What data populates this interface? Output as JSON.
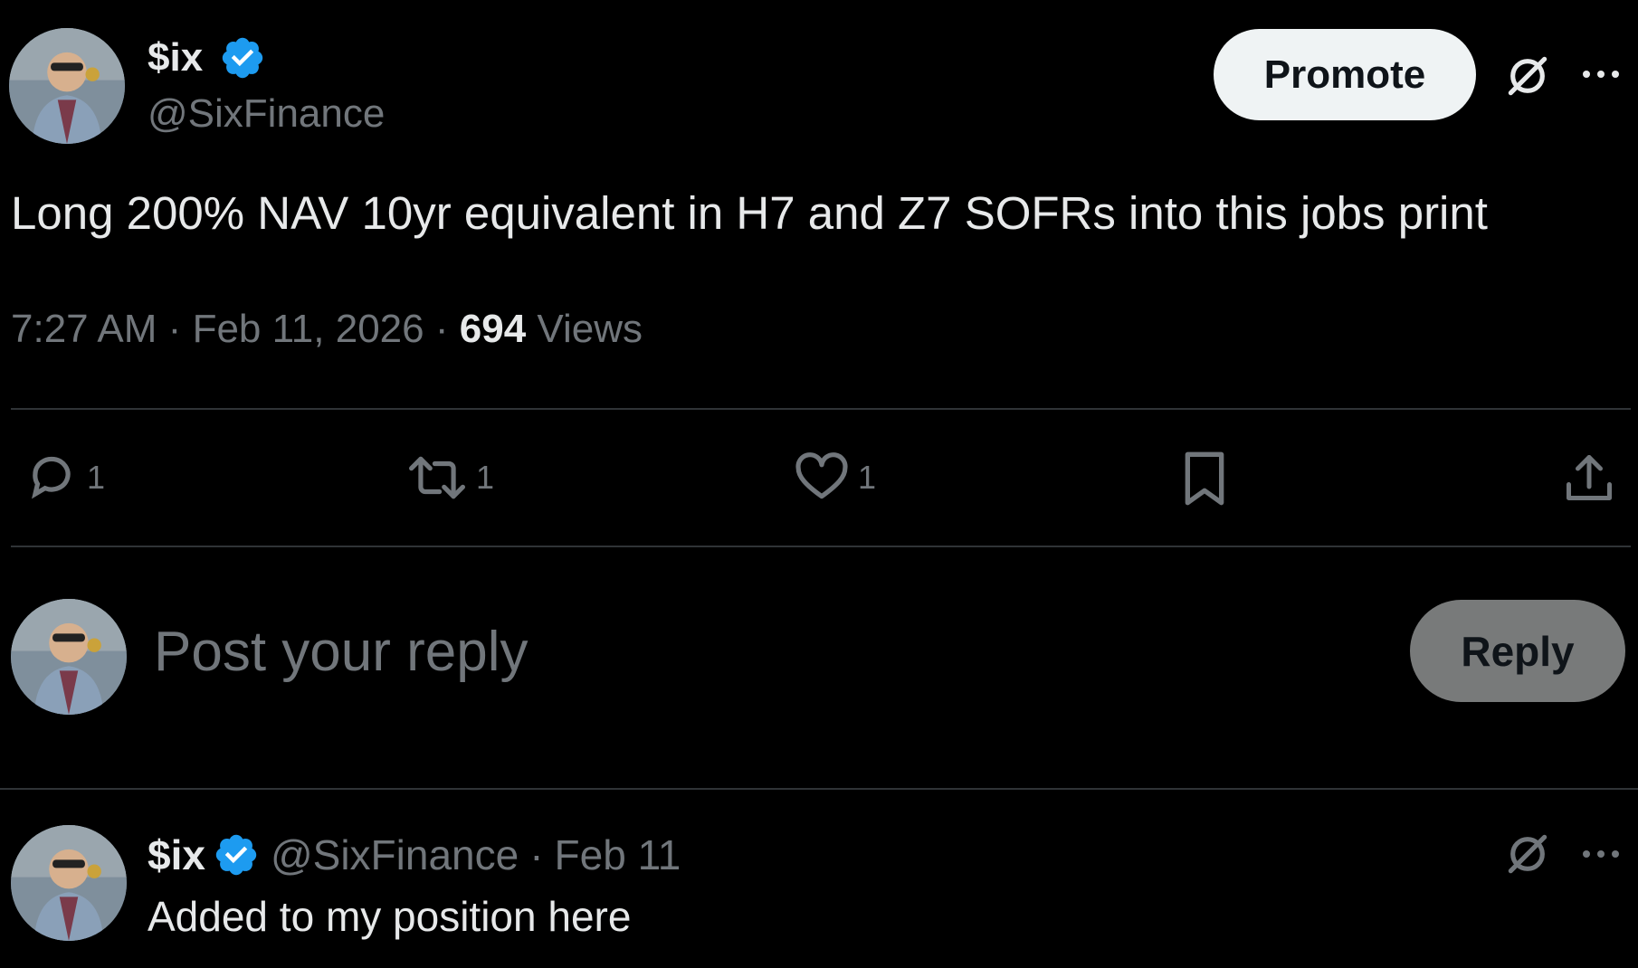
{
  "tweet": {
    "author": {
      "name": "$ix",
      "handle": "@SixFinance",
      "verified": true
    },
    "promote_label": "Promote",
    "text": "Long 200% NAV 10yr equivalent in H7 and Z7 SOFRs into this jobs print",
    "time": "7:27 AM",
    "date": "Feb 11, 2026",
    "views_count": "694",
    "views_label": "Views",
    "separator": "·",
    "actions": {
      "reply_count": "1",
      "repost_count": "1",
      "like_count": "1"
    }
  },
  "composer": {
    "placeholder": "Post your reply",
    "reply_label": "Reply"
  },
  "reply": {
    "name": "$ix",
    "handle": "@SixFinance",
    "separator": "·",
    "date": "Feb 11",
    "text": "Added to my position here"
  },
  "colors": {
    "background": "#000000",
    "text": "#e7e9ea",
    "muted": "#71767b",
    "divider": "#2f3336",
    "verified": "#1d9bf0"
  },
  "icons": [
    "grok-icon",
    "more-icon",
    "reply-icon",
    "repost-icon",
    "like-icon",
    "bookmark-icon",
    "share-icon",
    "verified-badge-icon"
  ]
}
